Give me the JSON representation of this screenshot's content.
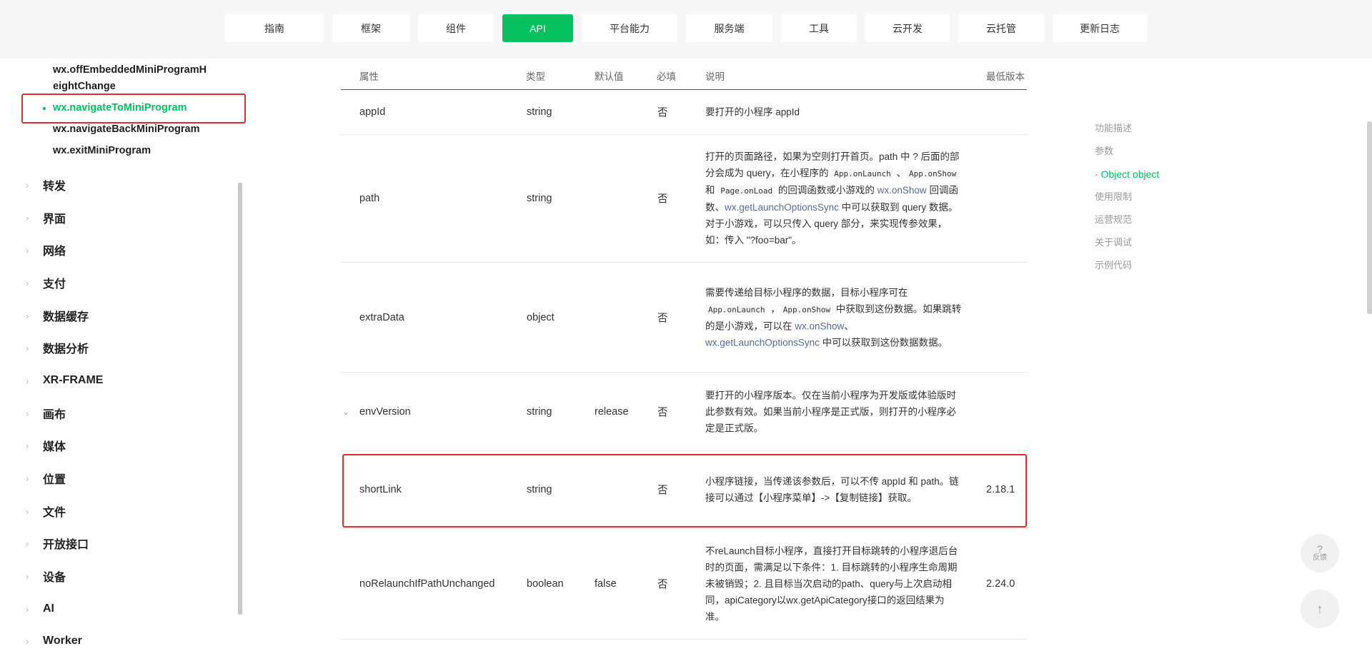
{
  "topnav": {
    "tabs": [
      {
        "label": "指南",
        "w": 106
      },
      {
        "label": "框架",
        "w": 106
      },
      {
        "label": "组件",
        "w": 106
      },
      {
        "label": "API",
        "w": 100,
        "active": true
      },
      {
        "label": "平台能力",
        "w": 134
      },
      {
        "label": "服务端",
        "w": 122
      },
      {
        "label": "工具",
        "w": 106
      },
      {
        "label": "云开发",
        "w": 122
      },
      {
        "label": "云托管",
        "w": 122
      },
      {
        "label": "更新日志",
        "w": 132
      }
    ]
  },
  "sidebar": {
    "sub_items": [
      {
        "label_line1": "wx.offEmbeddedMiniProgramH",
        "label_line2": "eightChange"
      },
      {
        "label": "wx.navigateToMiniProgram",
        "active": true
      },
      {
        "label": "wx.navigateBackMiniProgram"
      },
      {
        "label": "wx.exitMiniProgram"
      }
    ],
    "categories": [
      "转发",
      "界面",
      "网络",
      "支付",
      "数据缓存",
      "数据分析",
      "XR-FRAME",
      "画布",
      "媒体",
      "位置",
      "文件",
      "开放接口",
      "设备",
      "AI",
      "Worker"
    ]
  },
  "table": {
    "headers": {
      "attr": "属性",
      "type": "类型",
      "default": "默认值",
      "required": "必填",
      "desc": "说明",
      "version": "最低版本"
    },
    "rows": [
      {
        "attr": "appId",
        "type": "string",
        "default": "",
        "required": "否",
        "version": "",
        "desc": "要打开的小程序 appId"
      },
      {
        "attr": "path",
        "type": "string",
        "default": "",
        "required": "否",
        "version": ""
      },
      {
        "attr": "extraData",
        "type": "object",
        "default": "",
        "required": "否",
        "version": ""
      },
      {
        "attr": "envVersion",
        "type": "string",
        "default": "release",
        "required": "否",
        "version": "",
        "desc": "要打开的小程序版本。仅在当前小程序为开发版或体验版时此参数有效。如果当前小程序是正式版，则打开的小程序必定是正式版。"
      },
      {
        "attr": "shortLink",
        "type": "string",
        "default": "",
        "required": "否",
        "version": "2.18.1",
        "desc": "小程序链接，当传递该参数后，可以不传 appId 和 path。链接可以通过【小程序菜单】->【复制链接】获取。"
      },
      {
        "attr": "noRelaunchIfPathUnchanged",
        "type": "boolean",
        "default": "false",
        "required": "否",
        "version": "2.24.0",
        "desc": "不reLaunch目标小程序，直接打开目标跳转的小程序退后台时的页面，需满足以下条件：1. 目标跳转的小程序生命周期未被销毁；2. 且目标当次启动的path、query与上次启动相同，apiCategory以wx.getApiCategory接口的返回结果为准。"
      }
    ],
    "path_desc": {
      "t1": "打开的页面路径，如果为空则打开首页。path 中 ? 后面的部分会成为 query，在小程序的 ",
      "c1": "App.onLaunch",
      "t2": " 、",
      "c2": "App.onShow",
      "t3": " 和 ",
      "c3": "Page.onLoad",
      "t4": " 的回调函数或小游戏的 ",
      "l1": "wx.onShow",
      "t5": " 回调函数、",
      "l2": "wx.getLaunchOptionsSync",
      "t6": " 中可以获取到 query 数据。对于小游戏，可以只传入 query 部分，来实现传参效果，如：传入 \"?foo=bar\"。"
    },
    "extra_desc": {
      "t1": "需要传递给目标小程序的数据，目标小程序可在 ",
      "c1": "App.onLaunch",
      "t2": " ，",
      "c2": "App.onShow",
      "t3": " 中获取到这份数据。如果跳转的是小游戏，可以在 ",
      "l1": "wx.onShow",
      "t4": "、",
      "l2": "wx.getLaunchOptionsSync",
      "t5": " 中可以获取到这份数据数据。"
    }
  },
  "toc": {
    "items": [
      {
        "label": "功能描述"
      },
      {
        "label": "参数"
      },
      {
        "label": "· Object object",
        "active": true
      },
      {
        "label": "使用限制"
      },
      {
        "label": "运营规范"
      },
      {
        "label": "关于调试"
      },
      {
        "label": "示例代码"
      }
    ]
  },
  "float": {
    "feedback_q": "?",
    "feedback_label": "反馈",
    "top_arrow": "↑"
  },
  "colors": {
    "brand": "#07c160",
    "highlight": "#d9302b",
    "link": "#576b95"
  }
}
